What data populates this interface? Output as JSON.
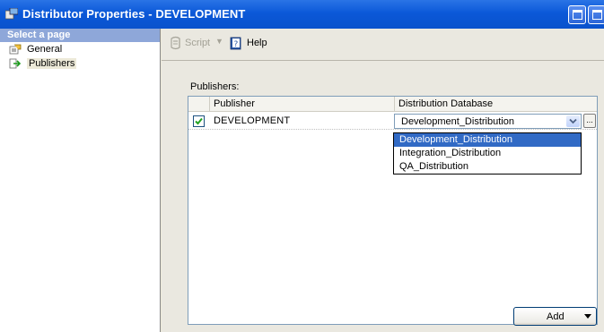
{
  "window": {
    "title": "Distributor Properties - DEVELOPMENT"
  },
  "left_pane": {
    "header": "Select a page",
    "items": [
      {
        "label": "General",
        "icon": "page-properties-icon"
      },
      {
        "label": "Publishers",
        "icon": "page-arrow-icon",
        "selected": true
      }
    ]
  },
  "toolbar": {
    "script_label": "Script",
    "script_enabled": false,
    "help_label": "Help"
  },
  "publishers": {
    "label": "Publishers:",
    "columns": [
      "Publisher",
      "Distribution Database"
    ],
    "rows": [
      {
        "checked": true,
        "publisher": "DEVELOPMENT",
        "distribution_database": "Development_Distribution"
      }
    ],
    "dropdown_options": [
      "Development_Distribution",
      "Integration_Distribution",
      "QA_Distribution"
    ],
    "dropdown_selected": "Development_Distribution",
    "ellipsis_label": "..."
  },
  "add_button": {
    "label": "Add"
  },
  "colors": {
    "titlebar": "#0b58d8",
    "selection": "#316ac5",
    "left_header": "#8ea7d9"
  }
}
